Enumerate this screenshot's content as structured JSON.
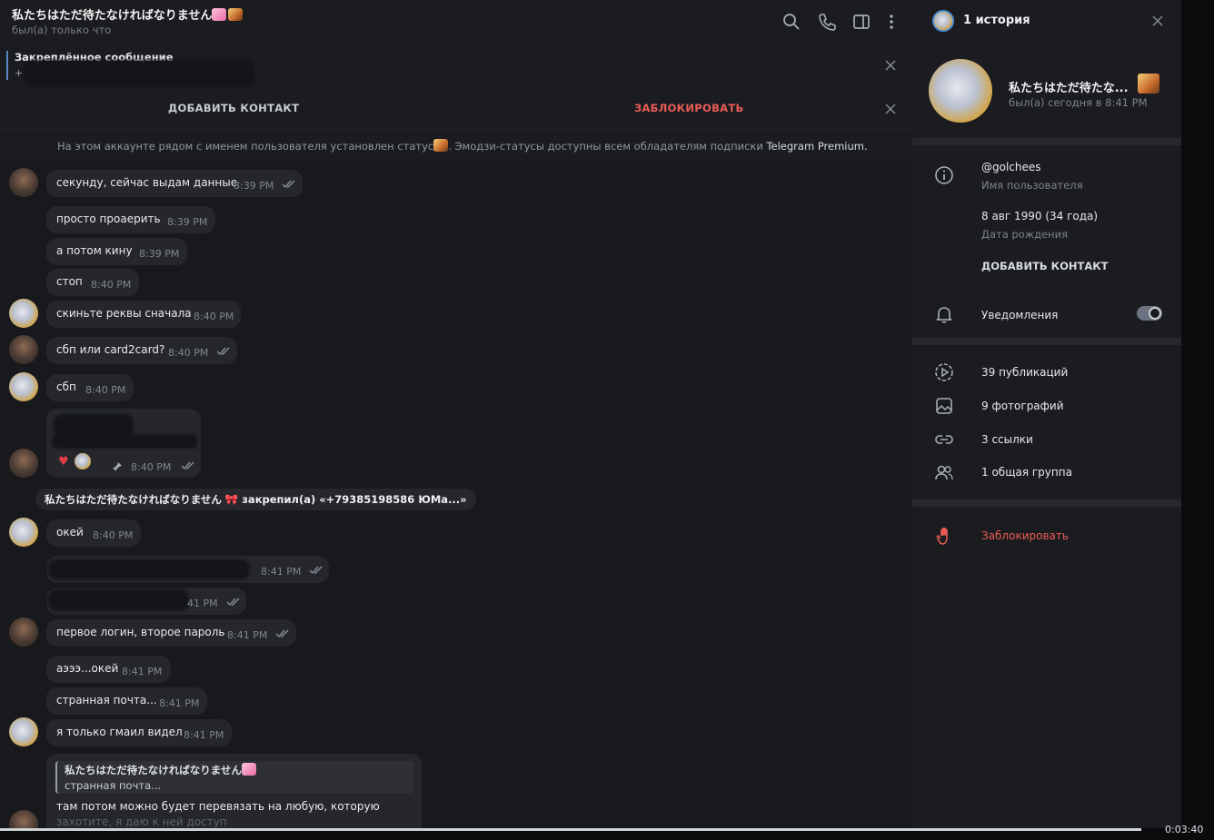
{
  "header": {
    "title": "私たちはただ待たなければなりません",
    "status": "был(а) только что"
  },
  "pinned": {
    "label": "Закреплённое сообщение",
    "prefix": "+"
  },
  "actions": {
    "add_contact": "ДОБАВИТЬ КОНТАКТ",
    "block": "ЗАБЛОКИРОВАТЬ"
  },
  "premium_notice": {
    "before": "На этом аккаунте рядом с именем пользователя установлен статус",
    "after": ". Эмодзи-статусы доступны всем обладателям подписки",
    "link": "Telegram Premium."
  },
  "messages": [
    {
      "text": "секунду, сейчас выдам данные",
      "time": "8:39 PM"
    },
    {
      "text": "просто проаерить",
      "time": "8:39 PM"
    },
    {
      "text": "а потом кину",
      "time": "8:39 PM"
    },
    {
      "text": "стоп",
      "time": "8:40 PM"
    },
    {
      "text": "скиньте реквы сначала",
      "time": "8:40 PM"
    },
    {
      "text": "сбп или card2card?",
      "time": "8:40 PM"
    },
    {
      "text": "сбп",
      "time": "8:40 PM"
    },
    {
      "text": "",
      "time": "8:40 PM"
    },
    {
      "text": "окей",
      "time": "8:40 PM"
    },
    {
      "text": "",
      "time": "8:41 PM"
    },
    {
      "text": "",
      "time": "41 PM"
    },
    {
      "text": "первое логин, второе пароль",
      "time": "8:41 PM"
    },
    {
      "text": "аэээ...окей",
      "time": "8:41 PM"
    },
    {
      "text": "странная почта...",
      "time": "8:41 PM"
    },
    {
      "text": "я только гмаил видел",
      "time": "8:41 PM"
    }
  ],
  "service_message": "私たちはただ待たなければなりません 🎀 закрепил(а) «+79385198586 ЮМа...»",
  "reply": {
    "quote_author": "私たちはただ待たなければなりません",
    "quote_text": "странная почта...",
    "text_line1": "там потом можно будет перевязать на любую, которую",
    "text_line2": "захотите, я даю к ней доступ"
  },
  "side": {
    "stories": "1 история",
    "name": "私たちはただ待たな...",
    "last_seen": "был(а) сегодня в 8:41 PM",
    "username": "@golchees",
    "username_label": "Имя пользователя",
    "birthday": "8 авг 1990 (34 года)",
    "birthday_label": "Дата рождения",
    "add_contact": "ДОБАВИТЬ КОНТАКТ",
    "notifications": "Уведомления",
    "notifications_on": true,
    "posts": "39 публикаций",
    "photos": "9 фотографий",
    "links": "3 ссылки",
    "groups": "1 общая группа",
    "block": "Заблокировать"
  },
  "video": {
    "time": "0:03:40",
    "progress": 0.94
  },
  "colors": {
    "accent_blue": "#5c86c8",
    "danger_red": "#e85c55",
    "bubble": "#25272c"
  }
}
